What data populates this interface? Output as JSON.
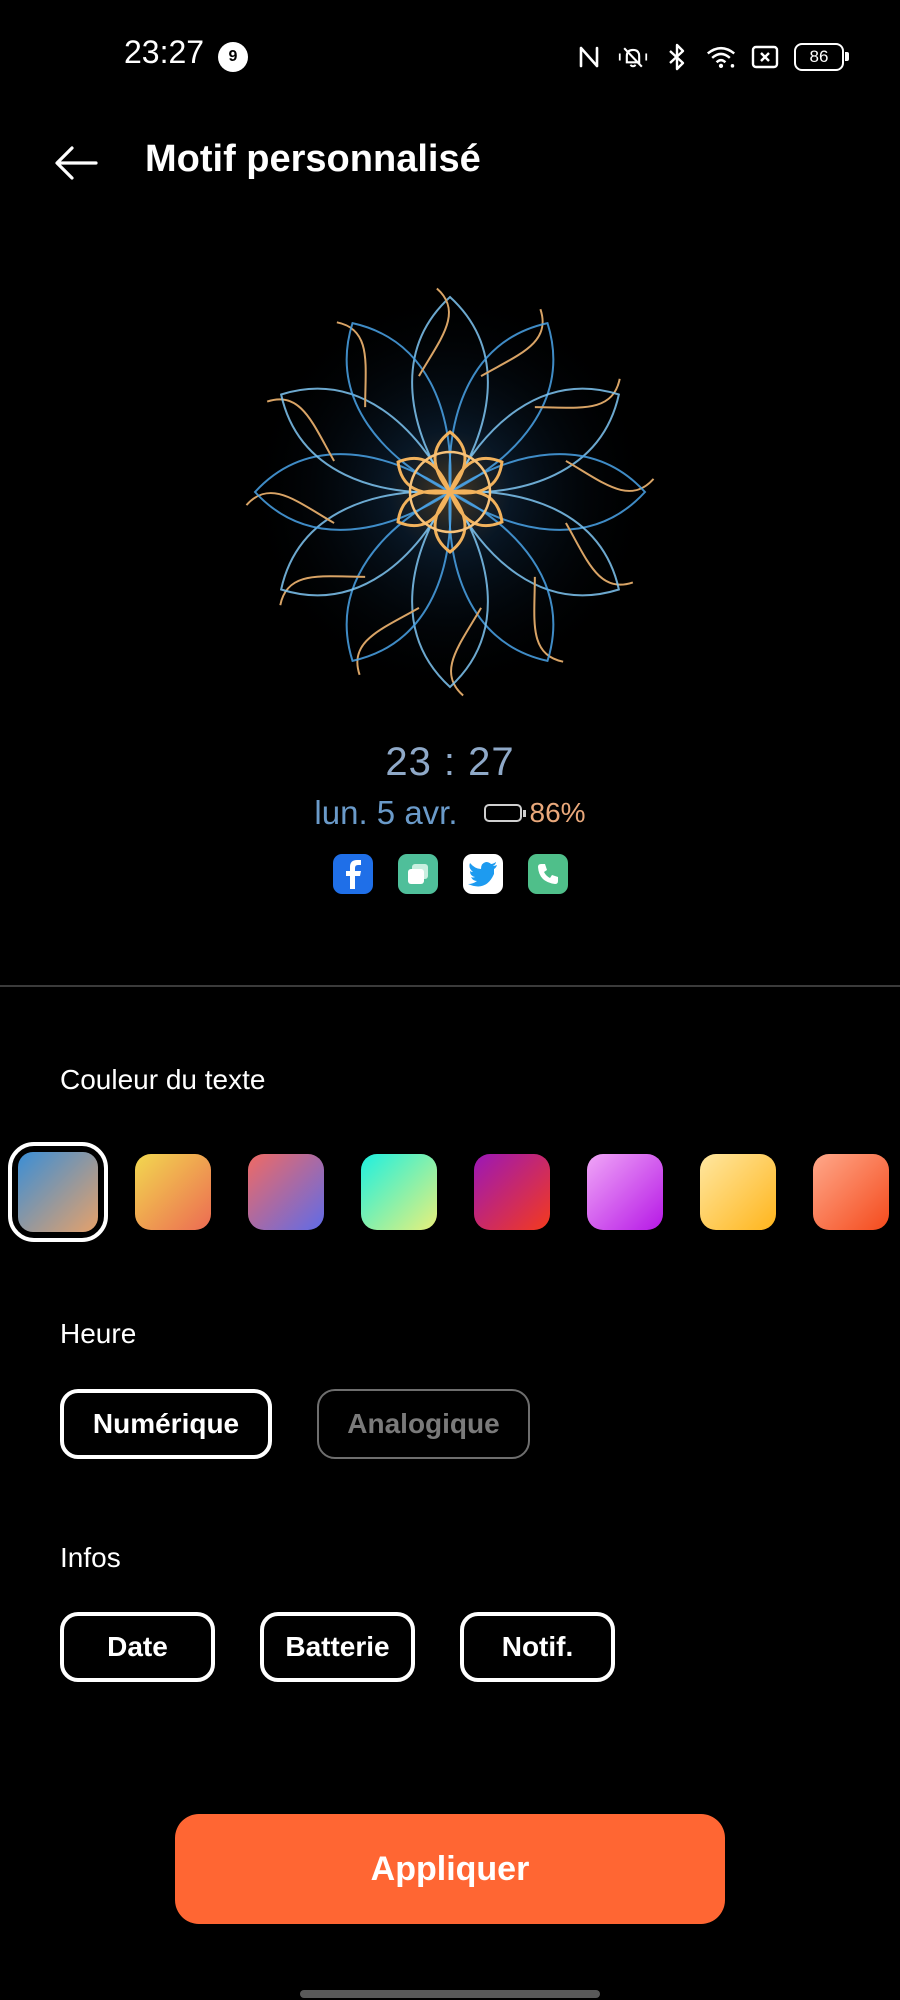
{
  "status_bar": {
    "time": "23:27",
    "notification_count": "9",
    "battery_level": "86",
    "icons": [
      "nfc-icon",
      "silent-bell-icon",
      "bluetooth-icon",
      "wifi-icon",
      "sim-off-icon",
      "battery-icon"
    ]
  },
  "header": {
    "title": "Motif personnalisé",
    "back_icon": "back-arrow-icon"
  },
  "preview": {
    "time": "23 : 27",
    "date": "lun. 5 avr.",
    "battery": "86%",
    "battery_fraction": 0.86,
    "apps": [
      "facebook-icon",
      "screen-mirror-icon",
      "twitter-icon",
      "phone-icon"
    ]
  },
  "text_color": {
    "label": "Couleur du texte",
    "selected_index": 0,
    "swatches": [
      {
        "from": "#3a8ed6",
        "to": "#e6a16a"
      },
      {
        "from": "#f2d84f",
        "to": "#ec6b52"
      },
      {
        "from": "#f06a63",
        "to": "#5f6be8"
      },
      {
        "from": "#1ef0e0",
        "to": "#e8f07a"
      },
      {
        "from": "#9b17b8",
        "to": "#f43a1c"
      },
      {
        "from": "#f0a6f7",
        "to": "#b618e6"
      },
      {
        "from": "#ffe7a0",
        "to": "#ffb51c"
      },
      {
        "from": "#ffa88a",
        "to": "#f44a1c"
      }
    ]
  },
  "time_style": {
    "label": "Heure",
    "options": [
      {
        "label": "Numérique",
        "selected": true
      },
      {
        "label": "Analogique",
        "selected": false
      }
    ]
  },
  "info": {
    "label": "Infos",
    "options": [
      {
        "label": "Date",
        "selected": true
      },
      {
        "label": "Batterie",
        "selected": true
      },
      {
        "label": "Notif.",
        "selected": true
      }
    ]
  },
  "apply_label": "Appliquer",
  "colors": {
    "accent": "#ff6633",
    "background": "#000000"
  }
}
